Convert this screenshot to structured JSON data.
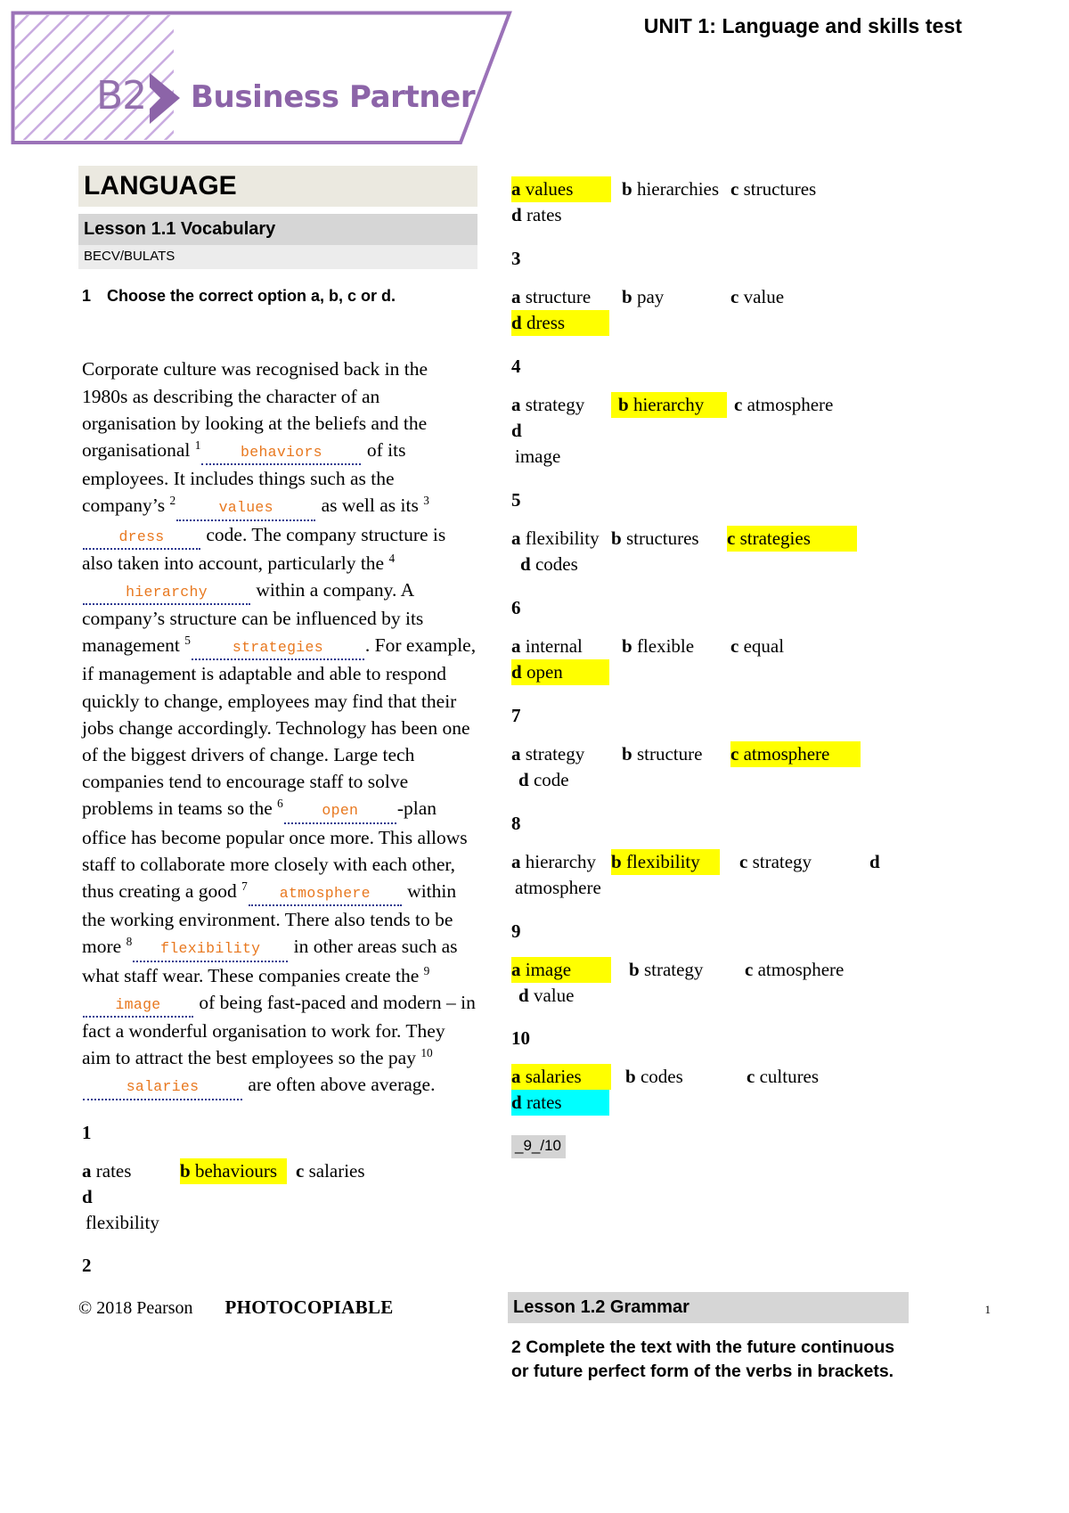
{
  "header": {
    "unit_title": "UNIT 1: Language and skills test",
    "logo_level": "B2",
    "logo_name": "Business Partner",
    "brand_color": "#8c64a8"
  },
  "left": {
    "section_banner": "LANGUAGE",
    "lesson_banner": "Lesson 1.1 Vocabulary",
    "sub_banner": "BECV/BULATS",
    "exercise_number": "1",
    "exercise_instruction": "Choose the correct option a, b, c or d.",
    "passage": {
      "s1": "Corporate culture was recognised back in the 1980s as describing the character of an organisation by looking at the beliefs and the organisational",
      "a1": "behaviors",
      "s2": "of its employees. It includes things such as the company’s",
      "a2": "values",
      "s3": "as well as its",
      "a3": "dress",
      "s4": "code. The company structure is also taken into account, particularly the",
      "a4": "hierarchy",
      "s5": "within a company. A company’s structure can be influenced by its management",
      "a5": "strategies",
      "s6": ". For example, if management is adaptable and able to respond quickly to change, employees may find that their jobs change accordingly. Technology has been one of the biggest drivers of change. Large tech companies tend to encourage staff to solve problems in teams so the",
      "a6": "open",
      "s7": "-plan office has become popular once more. This allows staff to collaborate more closely with each other, thus creating a good",
      "a7": "atmosphere",
      "s8": "within the working environment. There also tends to be more",
      "a8": "flexibility",
      "s9": "in other areas such as what staff wear. These companies create the",
      "a9": "image",
      "s10": "of being fast-paced and modern – in fact a wonderful organisation to work for. They aim to attract the best employees so the pay",
      "a10": "salaries",
      "s11": "are often above average."
    },
    "q1": {
      "number": "1",
      "options": [
        {
          "letter": "a",
          "text": "rates",
          "highlight": "none"
        },
        {
          "letter": "b",
          "text": "behaviours",
          "highlight": "yellow"
        },
        {
          "letter": "c",
          "text": "salaries",
          "highlight": "none"
        },
        {
          "letter": "d",
          "text": "",
          "highlight": "none"
        }
      ],
      "wrap_word": "flexibility"
    },
    "q2_number": "2"
  },
  "right": {
    "q2": {
      "options": [
        {
          "letter": "a",
          "text": "values",
          "highlight": "yellow"
        },
        {
          "letter": "b",
          "text": "hierarchies",
          "highlight": "none"
        },
        {
          "letter": "c",
          "text": "structures",
          "highlight": "none"
        },
        {
          "letter": "d",
          "text": "rates",
          "highlight": "none"
        }
      ]
    },
    "q3": {
      "number": "3",
      "options": [
        {
          "letter": "a",
          "text": "structure",
          "highlight": "none"
        },
        {
          "letter": "b",
          "text": "pay",
          "highlight": "none"
        },
        {
          "letter": "c",
          "text": "value",
          "highlight": "none"
        },
        {
          "letter": "d",
          "text": "dress",
          "highlight": "yellow"
        }
      ]
    },
    "q4": {
      "number": "4",
      "options": [
        {
          "letter": "a",
          "text": "strategy",
          "highlight": "none"
        },
        {
          "letter": "b",
          "text": "hierarchy",
          "highlight": "yellow"
        },
        {
          "letter": "c",
          "text": "atmosphere",
          "highlight": "none"
        },
        {
          "letter": "d",
          "text": "",
          "highlight": "none"
        }
      ],
      "wrap_word": "image"
    },
    "q5": {
      "number": "5",
      "options": [
        {
          "letter": "a",
          "text": "flexibility",
          "highlight": "none"
        },
        {
          "letter": "b",
          "text": "structures",
          "highlight": "none"
        },
        {
          "letter": "c",
          "text": "strategies",
          "highlight": "yellow"
        },
        {
          "letter": "d",
          "text": "codes",
          "highlight": "none"
        }
      ]
    },
    "q6": {
      "number": "6",
      "options": [
        {
          "letter": "a",
          "text": "internal",
          "highlight": "none"
        },
        {
          "letter": "b",
          "text": "flexible",
          "highlight": "none"
        },
        {
          "letter": "c",
          "text": "equal",
          "highlight": "none"
        },
        {
          "letter": "d",
          "text": "open",
          "highlight": "yellow"
        }
      ]
    },
    "q7": {
      "number": "7",
      "options": [
        {
          "letter": "a",
          "text": "strategy",
          "highlight": "none"
        },
        {
          "letter": "b",
          "text": "structure",
          "highlight": "none"
        },
        {
          "letter": "c",
          "text": "atmosphere",
          "highlight": "yellow"
        },
        {
          "letter": "d",
          "text": "code",
          "highlight": "none"
        }
      ]
    },
    "q8": {
      "number": "8",
      "options": [
        {
          "letter": "a",
          "text": "hierarchy",
          "highlight": "none"
        },
        {
          "letter": "b",
          "text": "flexibility",
          "highlight": "yellow"
        },
        {
          "letter": "c",
          "text": "strategy",
          "highlight": "none"
        },
        {
          "letter": "d",
          "text": "",
          "highlight": "none"
        }
      ],
      "wrap_word": "atmosphere"
    },
    "q9": {
      "number": "9",
      "options": [
        {
          "letter": "a",
          "text": "image",
          "highlight": "yellow"
        },
        {
          "letter": "b",
          "text": "strategy",
          "highlight": "none"
        },
        {
          "letter": "c",
          "text": "atmosphere",
          "highlight": "none"
        },
        {
          "letter": "d",
          "text": "value",
          "highlight": "none"
        }
      ]
    },
    "q10": {
      "number": "10",
      "options": [
        {
          "letter": "a",
          "text": "salaries",
          "highlight": "yellow"
        },
        {
          "letter": "b",
          "text": "codes",
          "highlight": "none"
        },
        {
          "letter": "c",
          "text": "cultures",
          "highlight": "none"
        },
        {
          "letter": "d",
          "text": "rates",
          "highlight": "cyan"
        }
      ]
    },
    "score": "_9_/10",
    "lesson_banner": "Lesson 1.2 Grammar",
    "grammar_instruction": "2 Complete the text with the future continuous or future perfect form of the verbs in brackets."
  },
  "footer": {
    "copyright": "© 2018 Pearson",
    "photocopiable": "PHOTOCOPIABLE",
    "page_number": "1"
  },
  "colors": {
    "highlight_yellow": "#ffff00",
    "highlight_cyan": "#00ffff",
    "answer_orange": "#e8781f",
    "dotted_blue": "#28368f",
    "brand_purple": "#8c64a8"
  }
}
